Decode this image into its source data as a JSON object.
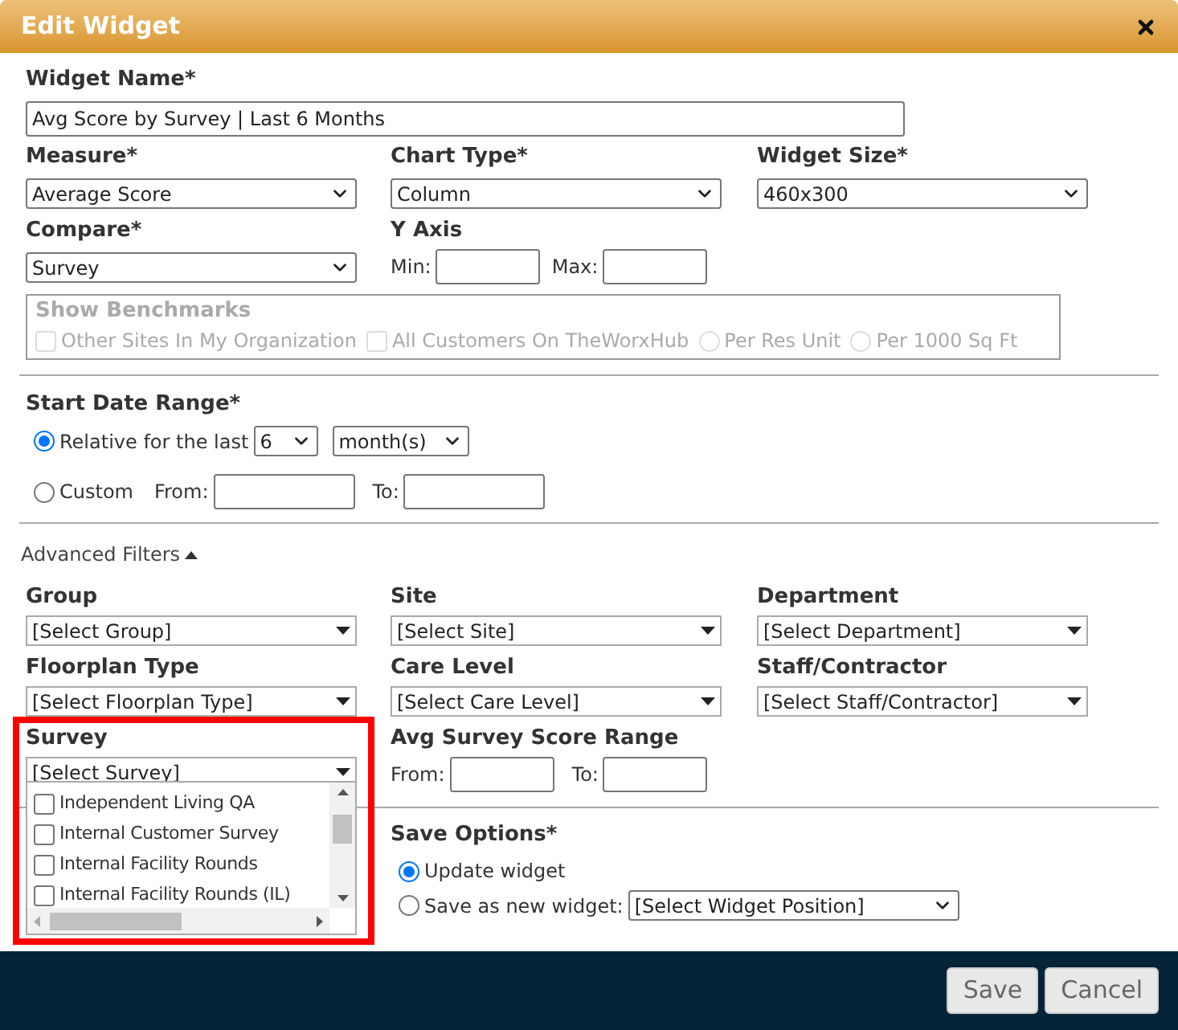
{
  "dialog": {
    "title": "Edit Widget"
  },
  "widget_name": {
    "label": "Widget Name*",
    "value": "Avg Score by Survey | Last 6 Months"
  },
  "measure": {
    "label": "Measure*",
    "value": "Average Score"
  },
  "chart_type": {
    "label": "Chart Type*",
    "value": "Column"
  },
  "widget_size": {
    "label": "Widget Size*",
    "value": "460x300"
  },
  "compare": {
    "label": "Compare*",
    "value": "Survey"
  },
  "y_axis": {
    "label": "Y Axis",
    "min_label": "Min:",
    "max_label": "Max:"
  },
  "benchmarks": {
    "title": "Show Benchmarks",
    "disabled": true,
    "options": [
      {
        "kind": "checkbox",
        "label": "Other Sites In My Organization",
        "checked": false
      },
      {
        "kind": "checkbox",
        "label": "All Customers On TheWorxHub",
        "checked": false
      },
      {
        "kind": "radio",
        "label": "Per Res Unit",
        "selected": false
      },
      {
        "kind": "radio",
        "label": "Per 1000 Sq Ft",
        "selected": false
      }
    ]
  },
  "start_date_range": {
    "label": "Start Date Range*",
    "options": [
      {
        "kind": "relative",
        "label": "Relative for the last",
        "selected": true,
        "count": "6",
        "unit": "month(s)"
      },
      {
        "kind": "custom",
        "label": "Custom",
        "selected": false,
        "from_label": "From:",
        "to_label": "To:"
      }
    ]
  },
  "advanced_filters": {
    "label": "Advanced Filters",
    "expanded": true,
    "filters": [
      {
        "label": "Group",
        "value": "[Select Group]"
      },
      {
        "label": "Site",
        "value": "[Select Site]"
      },
      {
        "label": "Department",
        "value": "[Select Department]"
      },
      {
        "label": "Floorplan Type",
        "value": "[Select Floorplan Type]"
      },
      {
        "label": "Care Level",
        "value": "[Select Care Level]"
      },
      {
        "label": "Staff/Contractor",
        "value": "[Select Staff/Contractor]"
      }
    ]
  },
  "survey": {
    "label": "Survey",
    "value": "[Select Survey]",
    "expanded": true,
    "options": [
      {
        "label": "Independent Living QA",
        "checked": false
      },
      {
        "label": "Internal Customer Survey",
        "checked": false
      },
      {
        "label": "Internal Facility Rounds",
        "checked": false
      },
      {
        "label": "Internal Facility Rounds (IL)",
        "checked": false
      }
    ]
  },
  "score_range": {
    "label": "Avg Survey Score Range",
    "from_label": "From:",
    "to_label": "To:"
  },
  "save_options": {
    "label": "Save Options*",
    "options": [
      {
        "kind": "plain",
        "label": "Update widget",
        "selected": true
      },
      {
        "kind": "position",
        "label": "Save as new widget:",
        "selected": false,
        "position": "[Select Widget Position]"
      }
    ]
  },
  "buttons": [
    "Save",
    "Cancel"
  ]
}
